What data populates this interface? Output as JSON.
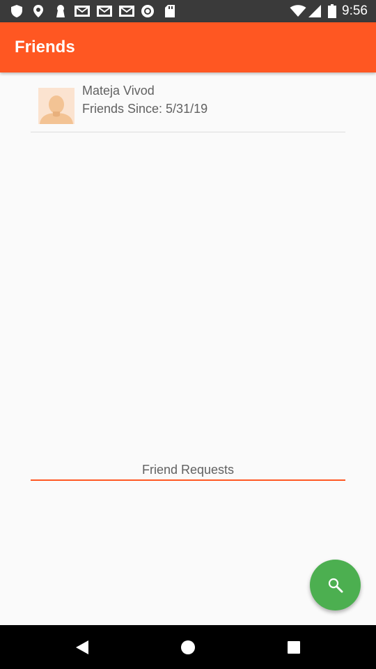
{
  "status_bar": {
    "time": "9:56",
    "left_icons": [
      "shield-icon",
      "location-pin-icon",
      "keyhole-icon",
      "mail-icon",
      "mail-icon",
      "mail-icon",
      "record-icon",
      "sd-card-icon"
    ],
    "right_icons": [
      "wifi-icon",
      "cell-signal-icon",
      "battery-icon"
    ]
  },
  "app_bar": {
    "title": "Friends",
    "color": "#ff5722"
  },
  "friends": [
    {
      "name": "Mateja Vivod",
      "since": "Friends Since: 5/31/19",
      "avatar": "avatar-placeholder-icon"
    }
  ],
  "requests": {
    "header": "Friend Requests"
  },
  "fab": {
    "icon": "search-icon",
    "color": "#4caf50"
  },
  "nav_bar": {
    "buttons": [
      "back-icon",
      "home-icon",
      "recents-icon"
    ]
  }
}
